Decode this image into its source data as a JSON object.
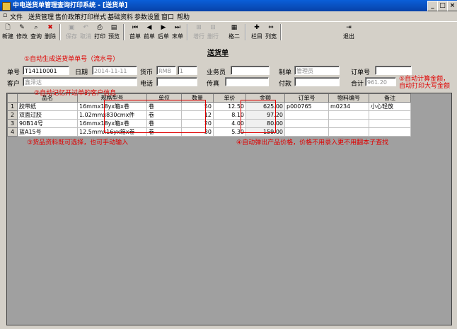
{
  "window": {
    "title": "中电送货单管理查询打印系统 - [送货单]"
  },
  "menu": [
    "文件",
    "送货管理",
    "售价政策",
    "打印样式",
    "基础资料",
    "参数设置",
    "窗口",
    "帮助"
  ],
  "toolbar": [
    {
      "label": "新建",
      "icon": "new-icon",
      "enabled": true
    },
    {
      "label": "修改",
      "icon": "edit-icon",
      "enabled": true
    },
    {
      "label": "查询",
      "icon": "search-icon",
      "enabled": true
    },
    {
      "label": "删除",
      "icon": "delete-icon",
      "enabled": true
    },
    {
      "label": "保存",
      "icon": "save-icon",
      "enabled": false
    },
    {
      "label": "取消",
      "icon": "undo-icon",
      "enabled": false
    },
    {
      "label": "打印",
      "icon": "print-icon",
      "enabled": true
    },
    {
      "label": "预览",
      "icon": "preview-icon",
      "enabled": true
    },
    {
      "label": "首单",
      "icon": "first-icon",
      "enabled": true
    },
    {
      "label": "前单",
      "icon": "prev-icon",
      "enabled": true
    },
    {
      "label": "后单",
      "icon": "next-icon",
      "enabled": true
    },
    {
      "label": "末单",
      "icon": "last-icon",
      "enabled": true
    },
    {
      "label": "增行",
      "icon": "add-row-icon",
      "enabled": false
    },
    {
      "label": "删行",
      "icon": "delete-row-icon",
      "enabled": false
    },
    {
      "label": "格二",
      "icon": "grid-icon",
      "enabled": true
    },
    {
      "label": "栏目",
      "icon": "columns-icon",
      "enabled": true
    },
    {
      "label": "列宽",
      "icon": "column-width-icon",
      "enabled": true
    },
    {
      "label": "退出",
      "icon": "exit-icon",
      "enabled": true
    }
  ],
  "form": {
    "heading": "送货单",
    "order_no_label": "单号",
    "order_no": "T14110001",
    "date_label": "日期",
    "date": "2014-11-11",
    "currency_label": "货币",
    "currency": "RMB",
    "rate": "1",
    "salesman_label": "业务员",
    "salesman": "",
    "creator_label": "制单",
    "creator": "管理员",
    "po_label": "订单号",
    "po": "",
    "customer_label": "客户",
    "customer": "鑫泽达",
    "phone_label": "电话",
    "phone": "",
    "fax_label": "传真",
    "fax": "",
    "payment_label": "付款",
    "payment": "",
    "total_label": "合计",
    "total": "961.20"
  },
  "annotations": {
    "a1": "①自动生成送货单单号（流水号）",
    "a2": "②自动记忆开过单的客户信息",
    "a3": "③货品资料既可选择，也可手动输入",
    "a4": "④自动弹出产品价格，价格不用录入更不用翻本子查找",
    "a5a": "⑤自动计算金额，",
    "a5b": "自动打印大写金额"
  },
  "table": {
    "columns": [
      "品名",
      "规格型号",
      "单位",
      "数量",
      "单价",
      "金额",
      "订单号",
      "物料编号",
      "备注"
    ],
    "rows": [
      {
        "n": "1",
        "name": "胶带纸",
        "spec": "16mmx18yx箱x卷",
        "unit": "卷",
        "qty": "50",
        "price": "12.50",
        "amount": "625.00",
        "po": "p000765",
        "mat": "m0234",
        "note": "小心轻放"
      },
      {
        "n": "2",
        "name": "双面过胶",
        "spec": "1.02mmx830cmx件",
        "unit": "卷",
        "qty": "12",
        "price": "8.10",
        "amount": "97.20",
        "po": "",
        "mat": "",
        "note": ""
      },
      {
        "n": "3",
        "name": "90B14号",
        "spec": "16mmx18yx箱x卷",
        "unit": "卷",
        "qty": "20",
        "price": "4.00",
        "amount": "80.00",
        "po": "",
        "mat": "",
        "note": ""
      },
      {
        "n": "4",
        "name": "蓝A15号",
        "spec": "12.5mmx16yx箱x卷",
        "unit": "卷",
        "qty": "30",
        "price": "5.30",
        "amount": "159.00",
        "po": "",
        "mat": "",
        "note": ""
      }
    ]
  },
  "colors": {
    "titlebar": "#0842a8",
    "annotation": "#e00000",
    "face": "#d4d0c8"
  }
}
